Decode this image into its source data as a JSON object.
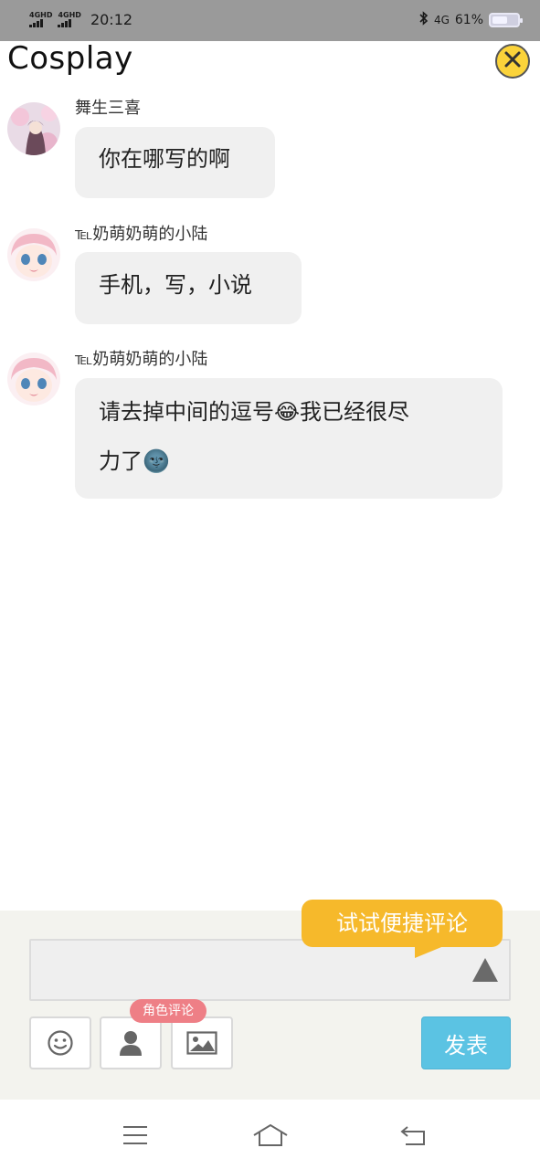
{
  "status_bar": {
    "signal1": "4GHD",
    "signal2": "4GHD",
    "time": "20:12",
    "bluetooth_icon": "bluetooth-icon",
    "network": "4G",
    "battery_percent": "61%",
    "battery_level": 0.61
  },
  "header": {
    "title": "Cosplay",
    "close_icon": "close-icon"
  },
  "messages": [
    {
      "sender": "舞生三喜",
      "text": "你在哪写的啊"
    },
    {
      "sender": "℡奶萌奶萌的小陆",
      "text": "手机，写，小说"
    },
    {
      "sender": "℡奶萌奶萌的小陆",
      "text_line1": "请去掉中间的逗号😂我已经很尽",
      "text_line2": "力了🌚"
    }
  ],
  "composer": {
    "input_value": "",
    "tooltip": "试试便捷评论",
    "expand_icon": "triangle-up-icon",
    "emoji_icon": "smiley-icon",
    "role_icon": "person-icon",
    "image_icon": "image-icon",
    "role_badge": "角色评论",
    "send_label": "发表"
  },
  "nav": {
    "menu_icon": "menu-icon",
    "home_icon": "home-icon",
    "back_icon": "back-icon"
  },
  "colors": {
    "tooltip": "#f6b92b",
    "send": "#5bc3e3",
    "badge": "#ee7f86",
    "close": "#fbd33a"
  }
}
